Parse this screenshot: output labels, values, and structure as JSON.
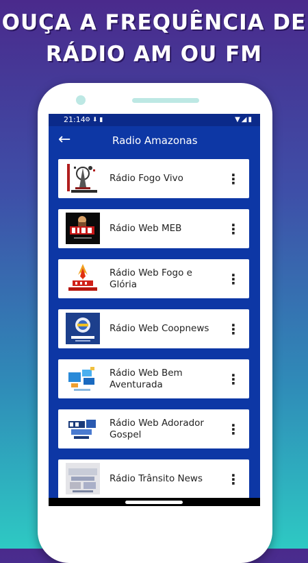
{
  "promo": {
    "headline_line1": "OUÇA A FREQUÊNCIA DE",
    "headline_line2": "RÁDIO AM OU FM"
  },
  "statusbar": {
    "time": "21:14",
    "left_icons": "⚙ ⬇ ▮",
    "right_icons": "▼◢▮"
  },
  "appbar": {
    "back_icon": "←",
    "title": "Radio Amazonas"
  },
  "stations": [
    {
      "name": "Rádio Fogo Vivo",
      "logo": "fogo-vivo-logo",
      "menu_icon": "⋮"
    },
    {
      "name": "Rádio Web MEB",
      "logo": "meb-logo",
      "menu_icon": "⋮"
    },
    {
      "name": "Rádio Web Fogo e Glória",
      "logo": "fogo-e-gloria-logo",
      "menu_icon": "⋮"
    },
    {
      "name": "Rádio Web Coopnews",
      "logo": "coopnews-logo",
      "menu_icon": "⋮"
    },
    {
      "name": "Rádio Web Bem Aventurada",
      "logo": "bem-aventurada-logo",
      "menu_icon": "⋮"
    },
    {
      "name": "Rádio Web Adorador Gospel",
      "logo": "adorador-gospel-logo",
      "menu_icon": "⋮"
    },
    {
      "name": "Rádio Trânsito News",
      "logo": "transito-news-logo",
      "menu_icon": "⋮"
    }
  ],
  "colors": {
    "background_top": "#4a2a8c",
    "background_bottom": "#2ec9c3",
    "appbar": "#0d37a5",
    "statusbar": "#0b2a8a"
  }
}
